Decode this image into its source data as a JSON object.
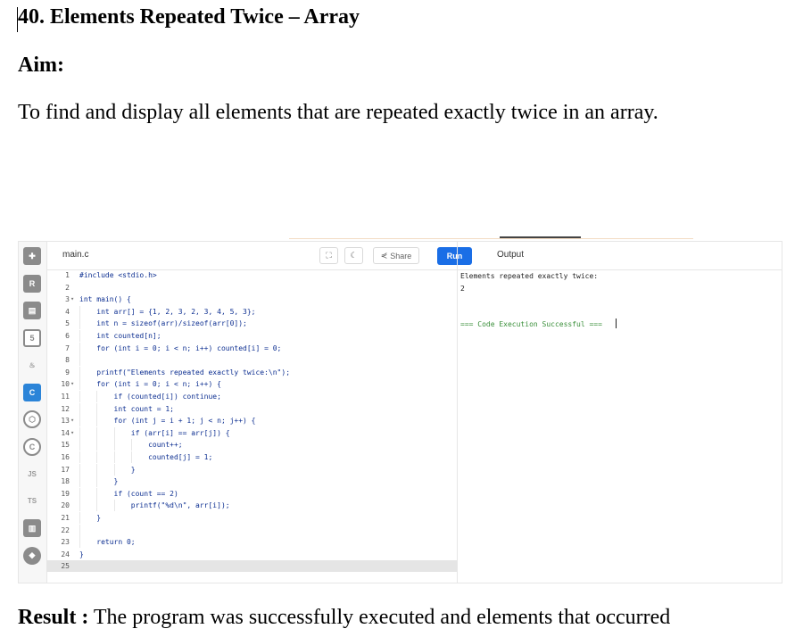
{
  "document": {
    "heading": "40. Elements Repeated Twice – Array",
    "aim_label": "Aim:",
    "aim_text": "To find and display all elements that are repeated exactly twice in an array.",
    "result_label": "Result :",
    "result_text": " The program was successfully executed and elements that occurred"
  },
  "ide": {
    "filename": "main.c",
    "share_label": "Share",
    "run_label": "Run",
    "output_label": "Output",
    "sidebar": [
      {
        "name": "python-icon",
        "glyph": "✚"
      },
      {
        "name": "r-icon",
        "glyph": "R"
      },
      {
        "name": "database-icon",
        "glyph": "▤"
      },
      {
        "name": "html5-icon",
        "glyph": "5"
      },
      {
        "name": "java-icon",
        "glyph": "♨"
      },
      {
        "name": "c-icon",
        "glyph": "C",
        "active": true
      },
      {
        "name": "cpp-icon",
        "glyph": "⬡"
      },
      {
        "name": "csharp-icon",
        "glyph": "C"
      },
      {
        "name": "js-icon",
        "glyph": "JS"
      },
      {
        "name": "ts-icon",
        "glyph": "TS"
      },
      {
        "name": "php-icon",
        "glyph": "▥"
      },
      {
        "name": "go-icon",
        "glyph": "◆"
      }
    ],
    "code_lines": [
      {
        "n": "1",
        "text": "#include <stdio.h>"
      },
      {
        "n": "2",
        "text": ""
      },
      {
        "n": "3",
        "text": "int main() {",
        "fold": true
      },
      {
        "n": "4",
        "text": "    int arr[] = {1, 2, 3, 2, 3, 4, 5, 3};",
        "indent": 1
      },
      {
        "n": "5",
        "text": "    int n = sizeof(arr)/sizeof(arr[0]);",
        "indent": 1
      },
      {
        "n": "6",
        "text": "    int counted[n];",
        "indent": 1
      },
      {
        "n": "7",
        "text": "    for (int i = 0; i < n; i++) counted[i] = 0;",
        "indent": 1
      },
      {
        "n": "8",
        "text": "",
        "indent": 1
      },
      {
        "n": "9",
        "text": "    printf(\"Elements repeated exactly twice:\\n\");",
        "indent": 1
      },
      {
        "n": "10",
        "text": "    for (int i = 0; i < n; i++) {",
        "fold": true,
        "indent": 1
      },
      {
        "n": "11",
        "text": "        if (counted[i]) continue;",
        "indent": 2
      },
      {
        "n": "12",
        "text": "        int count = 1;",
        "indent": 2
      },
      {
        "n": "13",
        "text": "        for (int j = i + 1; j < n; j++) {",
        "fold": true,
        "indent": 2
      },
      {
        "n": "14",
        "text": "            if (arr[i] == arr[j]) {",
        "fold": true,
        "indent": 3
      },
      {
        "n": "15",
        "text": "                count++;",
        "indent": 4
      },
      {
        "n": "16",
        "text": "                counted[j] = 1;",
        "indent": 4
      },
      {
        "n": "17",
        "text": "            }",
        "indent": 3
      },
      {
        "n": "18",
        "text": "        }",
        "indent": 2
      },
      {
        "n": "19",
        "text": "        if (count == 2)",
        "indent": 2
      },
      {
        "n": "20",
        "text": "            printf(\"%d\\n\", arr[i]);",
        "indent": 3
      },
      {
        "n": "21",
        "text": "    }",
        "indent": 1
      },
      {
        "n": "22",
        "text": "",
        "indent": 1
      },
      {
        "n": "23",
        "text": "    return 0;",
        "indent": 1
      },
      {
        "n": "24",
        "text": "}"
      },
      {
        "n": "25",
        "text": "",
        "active": true
      }
    ],
    "output_lines": [
      {
        "text": "Elements repeated exactly twice:"
      },
      {
        "text": "2"
      },
      {
        "text": ""
      },
      {
        "text": ""
      },
      {
        "text": "=== Code Execution Successful ===",
        "success": true
      }
    ]
  }
}
